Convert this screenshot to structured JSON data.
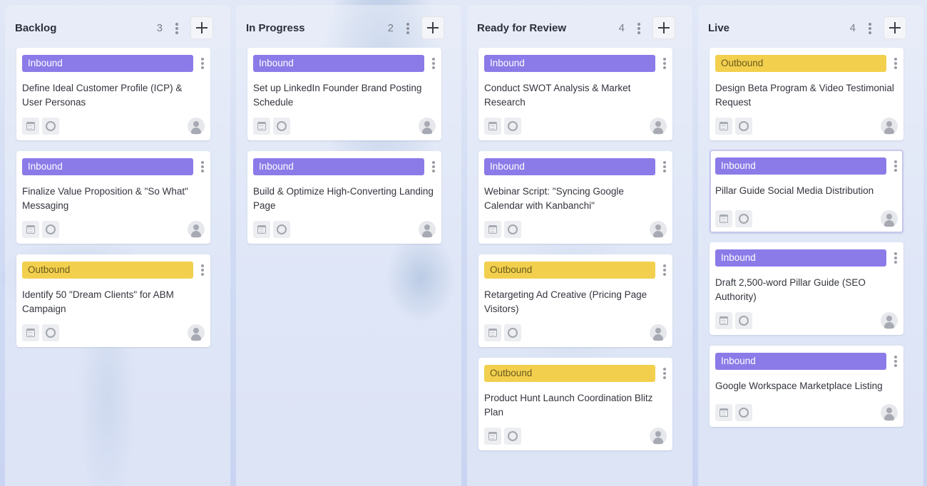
{
  "board": {
    "columns": [
      {
        "title": "Backlog",
        "count": "3",
        "cards": [
          {
            "tag": "Inbound",
            "title": "Define Ideal Customer Profile (ICP) & User Personas"
          },
          {
            "tag": "Inbound",
            "title": "Finalize Value Proposition & \"So What\" Messaging"
          },
          {
            "tag": "Outbound",
            "title": "Identify 50 \"Dream Clients\" for ABM Campaign"
          }
        ]
      },
      {
        "title": "In Progress",
        "count": "2",
        "cards": [
          {
            "tag": "Inbound",
            "title": "Set up LinkedIn Founder Brand Posting Schedule"
          },
          {
            "tag": "Inbound",
            "title": "Build & Optimize High-Converting Landing Page"
          }
        ]
      },
      {
        "title": "Ready for Review",
        "count": "4",
        "cards": [
          {
            "tag": "Inbound",
            "title": "Conduct SWOT Analysis & Market Research"
          },
          {
            "tag": "Inbound",
            "title": "Webinar Script: \"Syncing Google Calendar with Kanbanchi\""
          },
          {
            "tag": "Outbound",
            "title": "Retargeting Ad Creative (Pricing Page Visitors)"
          },
          {
            "tag": "Outbound",
            "title": "Product Hunt Launch Coordination Blitz Plan"
          }
        ]
      },
      {
        "title": "Live",
        "count": "4",
        "cards": [
          {
            "tag": "Outbound",
            "title": "Design Beta Program & Video Testimonial Request"
          },
          {
            "tag": "Inbound",
            "title": "Pillar Guide Social Media Distribution"
          },
          {
            "tag": "Inbound",
            "title": "Draft 2,500-word Pillar Guide (SEO Authority)"
          },
          {
            "tag": "Inbound",
            "title": "Google Workspace Marketplace Listing"
          }
        ]
      }
    ]
  },
  "colors": {
    "inbound": "#8b7be8",
    "outbound": "#f2d04e",
    "background": "#d6def4",
    "card": "#ffffff"
  },
  "icons": {
    "column_menu": "kebab-icon",
    "column_add": "plus-icon",
    "card_menu": "kebab-icon",
    "card_date": "calendar-icon",
    "card_status": "circle-status-icon",
    "card_assignee": "user-avatar-icon"
  }
}
